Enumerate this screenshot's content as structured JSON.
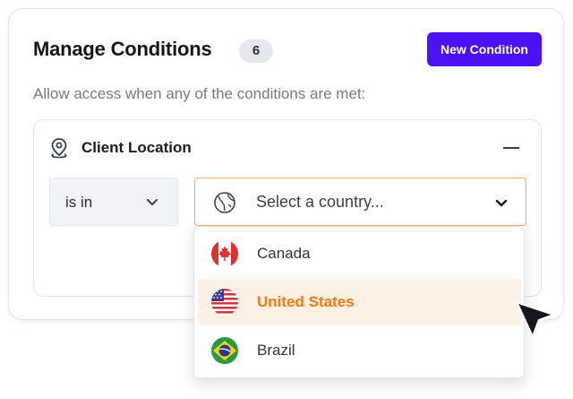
{
  "header": {
    "title": "Manage Conditions",
    "count": "6",
    "new_button_label": "New Condition",
    "subtitle": "Allow access when any of the conditions are met:"
  },
  "condition": {
    "section_title": "Client Location",
    "section_icon": "map-pin-icon",
    "operator": {
      "selected": "is in",
      "icon": "chevron-down-icon"
    },
    "country_select": {
      "placeholder": "Select a country...",
      "icon": "globe-icon",
      "focused": true
    },
    "options": [
      {
        "label": "Canada",
        "flag": "canada-flag-icon",
        "selected": false
      },
      {
        "label": "United States",
        "flag": "us-flag-icon",
        "selected": true
      },
      {
        "label": "Brazil",
        "flag": "brazil-flag-icon",
        "selected": false
      }
    ]
  },
  "colors": {
    "accent": "#4b12f5",
    "highlight_text": "#f47a12",
    "highlight_bg": "#fdf0e4",
    "focus_border": "#f3a95b"
  }
}
